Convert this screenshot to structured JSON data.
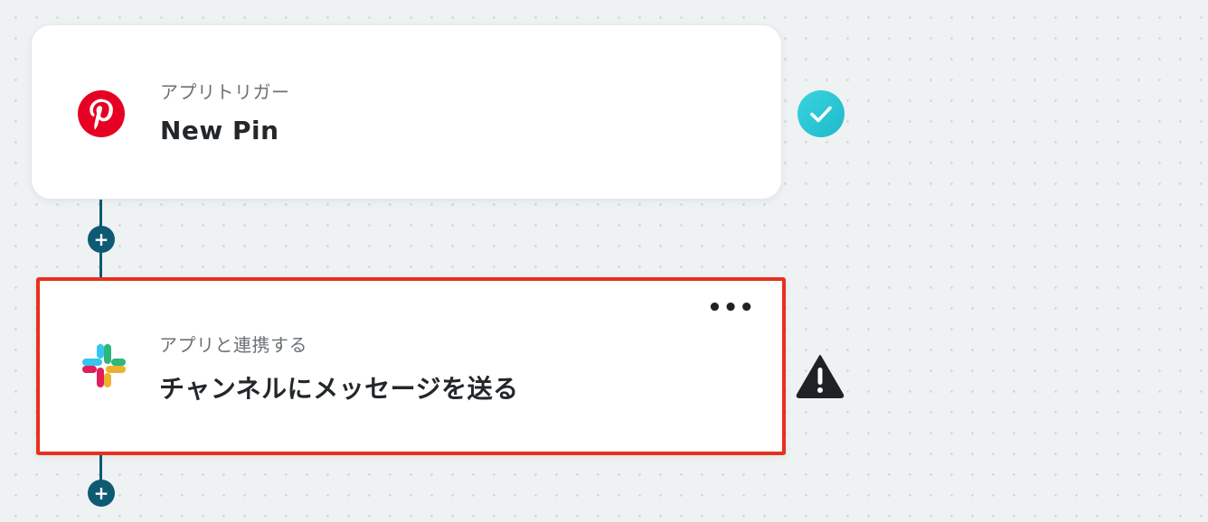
{
  "flow": {
    "steps": [
      {
        "label": "アプリトリガー",
        "title": "New Pin",
        "app_icon": "pinterest-icon",
        "status_icon": "check-circle-icon",
        "status_color": "#2ec9d6"
      },
      {
        "label": "アプリと連携する",
        "title": "チャンネルにメッセージを送る",
        "app_icon": "slack-icon",
        "more_label": "•••",
        "status_icon": "warning-triangle-icon",
        "status_color": "#1e2226"
      }
    ],
    "add_step_label": "+"
  },
  "colors": {
    "connector": "#0e5a73",
    "selected_border": "#e8301c",
    "pinterest_red": "#e60023",
    "slack_blue": "#36c5f0",
    "slack_green": "#2eb67d",
    "slack_yellow": "#ecb22e",
    "slack_red": "#e01e5a"
  }
}
